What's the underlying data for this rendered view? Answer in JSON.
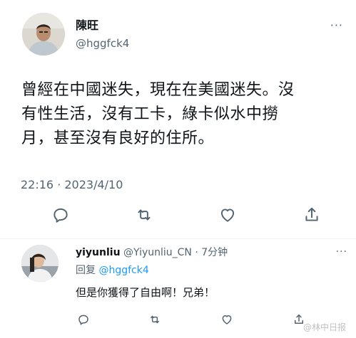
{
  "tweet": {
    "display_name": "陳旺",
    "handle": "@hggfck4",
    "text": "曾經在中國迷失，現在在美國迷失。沒\n有性生活，沒有工卡，綠卡似水中撈\n月，甚至沒有良好的住所。",
    "timestamp": "22:16 · 2023/4/10",
    "more": "···"
  },
  "actions": {
    "icons": [
      "reply-icon",
      "retweet-icon",
      "like-icon",
      "share-icon"
    ]
  },
  "reply": {
    "name": "yiyunliu",
    "meta": "@Yiyunliu_CN · 7分钟",
    "replying_label": "回复",
    "replying_to": "@hggfck4",
    "text": "但是你獲得了自由啊！兄弟！",
    "more": "···"
  },
  "watermark": "@林中日报",
  "colors": {
    "text": "#0f1419",
    "secondary": "#536471",
    "accent": "#1d9bf0",
    "divider": "#eff3f4"
  }
}
